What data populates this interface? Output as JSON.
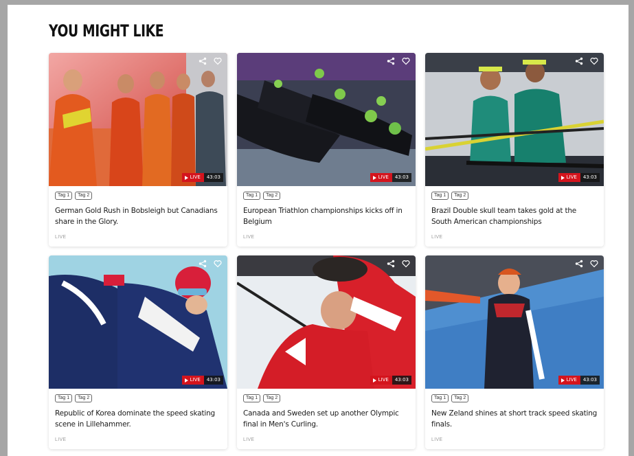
{
  "section": {
    "title": "YOU MIGHT LIKE"
  },
  "colors": {
    "live_red": "#d4141d",
    "duration_bg": "#141414",
    "page_bg": "#ffffff",
    "frame_bg": "#a6a6a6"
  },
  "cards": [
    {
      "tags": [
        "Tag 1",
        "Tag 2"
      ],
      "title": "German Gold Rush in Bobsleigh but Canadians share in the Glory.",
      "status": "LIVE",
      "badge": "LIVE",
      "duration": "43:03",
      "share_icon": "share-icon",
      "like_icon": "heart-icon"
    },
    {
      "tags": [
        "Tag 1",
        "Tag 2"
      ],
      "title": "European Triathlon championships kicks off in Belgium",
      "status": "LIVE",
      "badge": "LIVE",
      "duration": "43:03",
      "share_icon": "share-icon",
      "like_icon": "heart-icon"
    },
    {
      "tags": [
        "Tag 1",
        "Tag 2"
      ],
      "title": "Brazil Double skull team takes gold at the South American championships",
      "status": "LIVE",
      "badge": "LIVE",
      "duration": "43:03",
      "share_icon": "share-icon",
      "like_icon": "heart-icon"
    },
    {
      "tags": [
        "Tag 1",
        "Tag 2"
      ],
      "title": "Republic of Korea dominate the speed skating scene in Lillehammer.",
      "status": "LIVE",
      "badge": "LIVE",
      "duration": "43:03",
      "share_icon": "share-icon",
      "like_icon": "heart-icon"
    },
    {
      "tags": [
        "Tag 1",
        "Tag 2"
      ],
      "title": "Canada and Sweden set up another Olympic final in Men's Curling.",
      "status": "LIVE",
      "badge": "LIVE",
      "duration": "43:03",
      "share_icon": "share-icon",
      "like_icon": "heart-icon"
    },
    {
      "tags": [
        "Tag 1",
        "Tag 2"
      ],
      "title": "New Zeland shines at short track speed skating finals.",
      "status": "LIVE",
      "badge": "LIVE",
      "duration": "43:03",
      "share_icon": "share-icon",
      "like_icon": "heart-icon"
    }
  ]
}
